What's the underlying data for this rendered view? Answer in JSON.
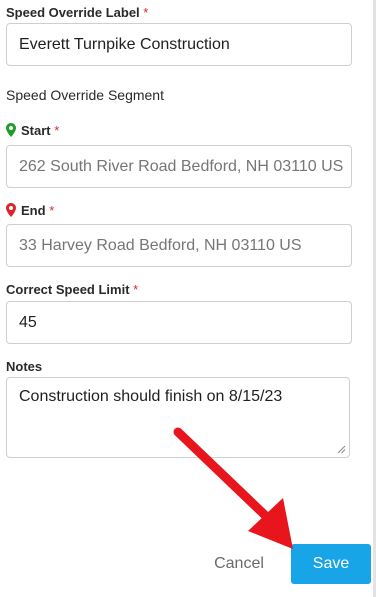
{
  "form": {
    "label_field": {
      "label": "Speed Override Label",
      "required_mark": "*",
      "value": "Everett Turnpike Construction"
    },
    "segment_heading": "Speed Override Segment",
    "start_field": {
      "label": "Start",
      "required_mark": "*",
      "value": "262 South River Road Bedford, NH 03110 US",
      "pin_color": "#1f9e2c"
    },
    "end_field": {
      "label": "End",
      "required_mark": "*",
      "value": "33 Harvey Road Bedford, NH 03110 US",
      "pin_color": "#d9262b"
    },
    "speed_field": {
      "label": "Correct Speed Limit",
      "required_mark": "*",
      "value": "45"
    },
    "notes_field": {
      "label": "Notes",
      "value": "Construction should finish on 8/15/23"
    }
  },
  "actions": {
    "cancel_label": "Cancel",
    "save_label": "Save",
    "save_color": "#17a5e8"
  },
  "annotation": {
    "arrow_icon": "red-arrow-pointing-to-save",
    "color": "#e8161c"
  }
}
